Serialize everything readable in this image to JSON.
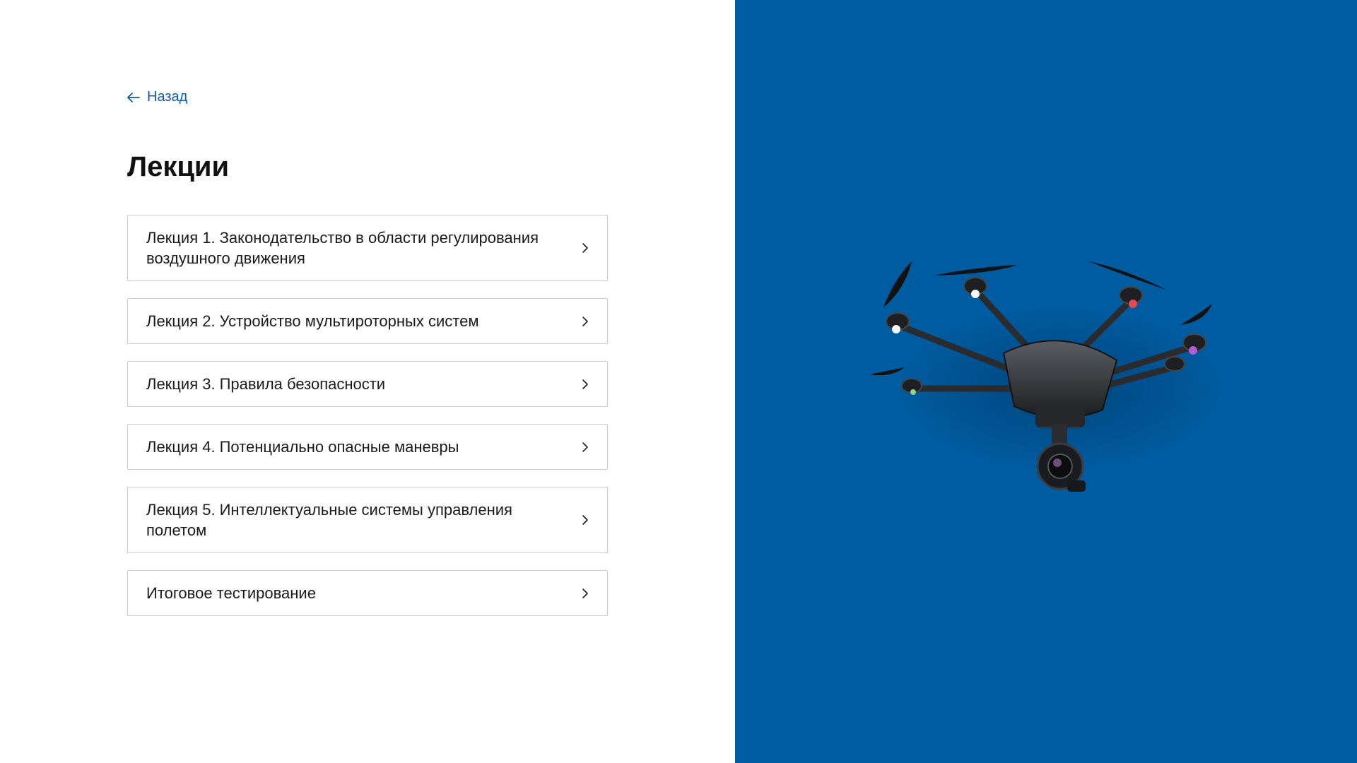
{
  "nav": {
    "back_label": "Назад"
  },
  "page": {
    "title": "Лекции"
  },
  "lectures": [
    {
      "number": "Лекция 1.",
      "title": "Законодательство в области регулирования воздушного движения"
    },
    {
      "number": "Лекция 2.",
      "title": "Устройство мультироторных систем"
    },
    {
      "number": "Лекция 3.",
      "title": "Правила безопасности"
    },
    {
      "number": "Лекция 4.",
      "title": "Потенциально опасные маневры"
    },
    {
      "number": "Лекция 5.",
      "title": "Интеллектуальные системы управления полетом"
    }
  ],
  "final_test": {
    "title": "Итоговое тестирование"
  },
  "colors": {
    "accent": "#0f5ba6",
    "panel_background": "#005ca1",
    "item_border": "#c9ccd1"
  },
  "icons": {
    "back": "arrow-left-icon",
    "item": "chevron-right-icon",
    "illustration": "hexacopter-drone"
  }
}
